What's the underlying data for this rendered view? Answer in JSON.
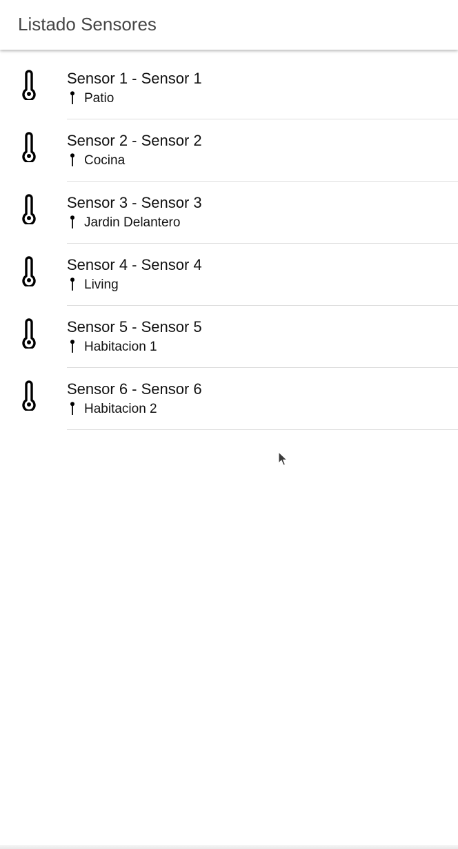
{
  "toolbar": {
    "title": "Listado Sensores"
  },
  "sensors": [
    {
      "name": "Sensor 1 - Sensor 1",
      "location": "Patio",
      "icon": "thermometer-icon",
      "location_icon": "pin-icon"
    },
    {
      "name": "Sensor 2 - Sensor 2",
      "location": "Cocina",
      "icon": "thermometer-icon",
      "location_icon": "pin-icon"
    },
    {
      "name": "Sensor 3 - Sensor 3",
      "location": "Jardin Delantero",
      "icon": "thermometer-icon",
      "location_icon": "pin-icon"
    },
    {
      "name": "Sensor 4 - Sensor 4",
      "location": "Living",
      "icon": "thermometer-icon",
      "location_icon": "pin-icon"
    },
    {
      "name": "Sensor 5 - Sensor 5",
      "location": "Habitacion 1",
      "icon": "thermometer-icon",
      "location_icon": "pin-icon"
    },
    {
      "name": "Sensor 6 - Sensor 6",
      "location": "Habitacion 2",
      "icon": "thermometer-icon",
      "location_icon": "pin-icon"
    }
  ],
  "colors": {
    "background": "#ffffff",
    "title_text": "#454545",
    "item_text": "#111111",
    "divider": "#dcdcdc"
  }
}
